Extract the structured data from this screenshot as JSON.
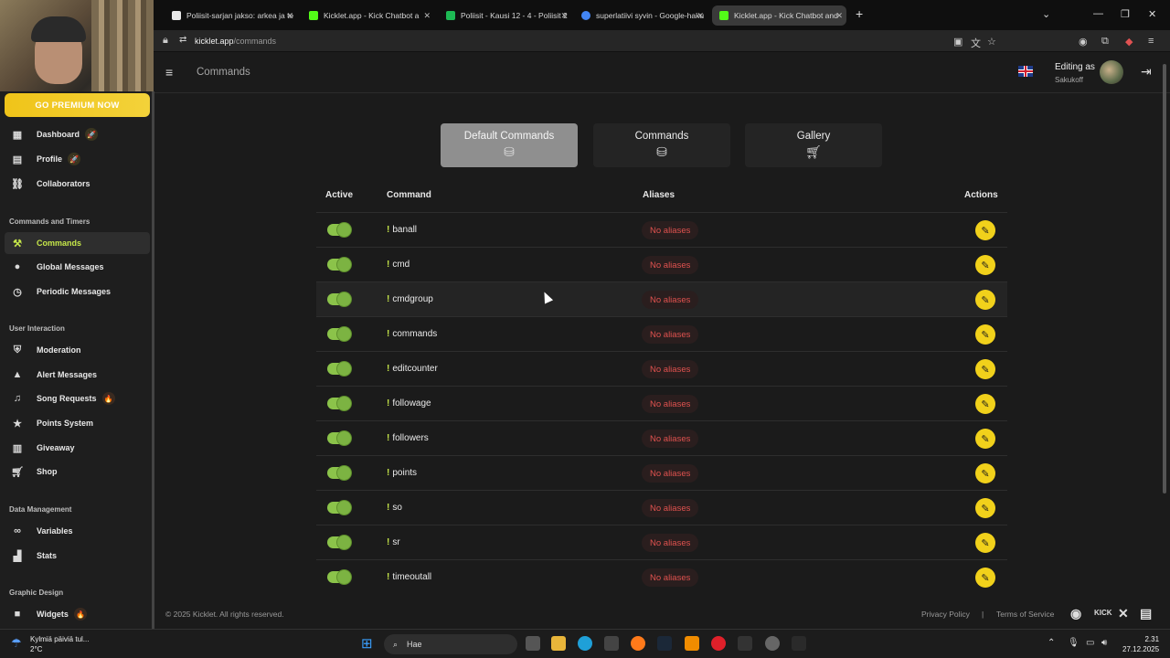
{
  "browser": {
    "tabs": [
      {
        "title": "Poliisit-sarjan jakso: arkea ja te",
        "color": "#e9e9e9"
      },
      {
        "title": "Kicklet.app - Kick Chatbot a",
        "color": "#53fc18"
      },
      {
        "title": "Poliisit - Kausi 12 - 4 - Poliisit 2",
        "color": "#1db954"
      },
      {
        "title": "superlatiivi syvin - Google-haku",
        "color": "#4285f4"
      },
      {
        "title": "Kicklet.app - Kick Chatbot and",
        "color": "#53fc18"
      }
    ],
    "url_host": "kicklet.app",
    "url_path": "/commands"
  },
  "sidebar": {
    "premium_label": "GO PREMIUM NOW",
    "items": [
      {
        "label": "Dashboard",
        "icon": "grid-icon",
        "badge": "🚀"
      },
      {
        "label": "Profile",
        "icon": "id-card-icon",
        "badge": "🚀"
      },
      {
        "label": "Collaborators",
        "icon": "handshake-icon"
      },
      {
        "label": "Commands",
        "icon": "hammer-icon"
      },
      {
        "label": "Global Messages",
        "icon": "chat-bubble-icon"
      },
      {
        "label": "Periodic Messages",
        "icon": "clock-icon"
      },
      {
        "label": "Moderation",
        "icon": "shield-icon"
      },
      {
        "label": "Alert Messages",
        "icon": "warning-icon"
      },
      {
        "label": "Song Requests",
        "icon": "music-icon",
        "badge": "🔥"
      },
      {
        "label": "Points System",
        "icon": "star-icon"
      },
      {
        "label": "Giveaway",
        "icon": "gift-icon"
      },
      {
        "label": "Shop",
        "icon": "cart-icon"
      },
      {
        "label": "Variables",
        "icon": "link-icon"
      },
      {
        "label": "Stats",
        "icon": "bar-chart-icon"
      },
      {
        "label": "Widgets",
        "icon": "video-icon",
        "badge": "🔥"
      }
    ],
    "sections": [
      "Commands and Timers",
      "User Interaction",
      "Data Management",
      "Graphic Design"
    ]
  },
  "header": {
    "breadcrumb": "Commands",
    "editing_as": "Editing as",
    "username": "Sakukoff"
  },
  "command_tabs": [
    {
      "label": "Default Commands",
      "icon": "database-check-icon",
      "active": true
    },
    {
      "label": "Commands",
      "icon": "database-check-icon",
      "active": false
    },
    {
      "label": "Gallery",
      "icon": "cart-icon",
      "active": false
    }
  ],
  "table": {
    "headers": {
      "active": "Active",
      "command": "Command",
      "aliases": "Aliases",
      "actions": "Actions"
    },
    "rows": [
      {
        "name": "banall",
        "aliases": "No aliases",
        "active": true
      },
      {
        "name": "cmd",
        "aliases": "No aliases",
        "active": true
      },
      {
        "name": "cmdgroup",
        "aliases": "No aliases",
        "active": true
      },
      {
        "name": "commands",
        "aliases": "No aliases",
        "active": true
      },
      {
        "name": "editcounter",
        "aliases": "No aliases",
        "active": true
      },
      {
        "name": "followage",
        "aliases": "No aliases",
        "active": true
      },
      {
        "name": "followers",
        "aliases": "No aliases",
        "active": true
      },
      {
        "name": "points",
        "aliases": "No aliases",
        "active": true
      },
      {
        "name": "so",
        "aliases": "No aliases",
        "active": true
      },
      {
        "name": "sr",
        "aliases": "No aliases",
        "active": true
      },
      {
        "name": "timeoutall",
        "aliases": "No aliases",
        "active": true
      }
    ],
    "bang": "!"
  },
  "footer": {
    "copyright": "© 2025 Kicklet. All rights reserved.",
    "privacy": "Privacy Policy",
    "separator": "|",
    "terms": "Terms of Service",
    "kick": "KICK"
  },
  "taskbar": {
    "weather_line1": "Kylmiä päiviä tul...",
    "weather_line2": "2°C",
    "search_label": "Hae",
    "time": "2.31",
    "date": "27.12.2025"
  },
  "colors": {
    "accent_green": "#c6e74a",
    "premium_yellow": "#f0c419",
    "edit_yellow": "#f1d11b",
    "alias_red": "#e0524f"
  }
}
